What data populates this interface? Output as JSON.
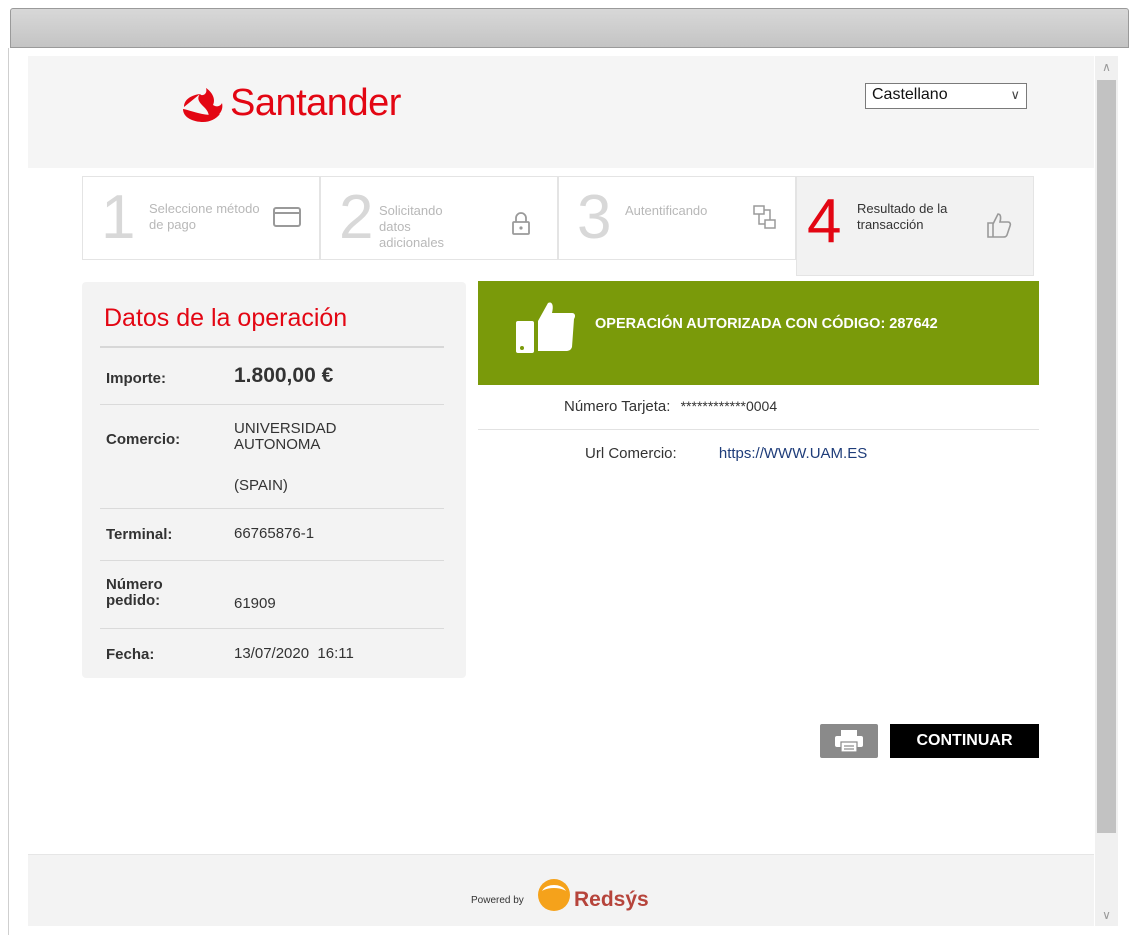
{
  "header": {
    "logo_text": "Santander",
    "language": {
      "selected": "Castellano"
    }
  },
  "steps": [
    {
      "number": "1",
      "label": "Seleccione método de pago",
      "icon": "credit-card-icon",
      "state": "done"
    },
    {
      "number": "2",
      "label": "Solicitando datos adicionales",
      "icon": "lock-icon",
      "state": "done"
    },
    {
      "number": "3",
      "label": "Autentificando",
      "icon": "network-icon",
      "state": "done"
    },
    {
      "number": "4",
      "label": "Resultado de la transacción",
      "icon": "thumbs-up-icon",
      "state": "active"
    }
  ],
  "operation": {
    "title": "Datos de la operación",
    "fields": {
      "importe": {
        "label": "Importe:",
        "value": "1.800,00 €"
      },
      "comercio": {
        "label": "Comercio:",
        "value": "UNIVERSIDAD AUTONOMA",
        "value2": "(SPAIN)"
      },
      "terminal": {
        "label": "Terminal:",
        "value": "66765876-1"
      },
      "pedido": {
        "label": "Número pedido:",
        "value": "61909"
      },
      "fecha": {
        "label": "Fecha:",
        "value": "13/07/2020  16:11"
      }
    }
  },
  "result": {
    "status_text": "OPERACIÓN AUTORIZADA CON CÓDIGO: 287642",
    "status_color": "#7a9a0a",
    "card_label": "Número Tarjeta:",
    "card_value": "************0004",
    "url_label": "Url Comercio:",
    "url_value": "https://WWW.UAM.ES"
  },
  "actions": {
    "print_icon": "printer-icon",
    "continue_label": "CONTINUAR"
  },
  "footer": {
    "powered_by": "Powered by",
    "brand": "Redsýs"
  },
  "colors": {
    "brand_red": "#e30613",
    "success_green": "#7a9a0a"
  }
}
